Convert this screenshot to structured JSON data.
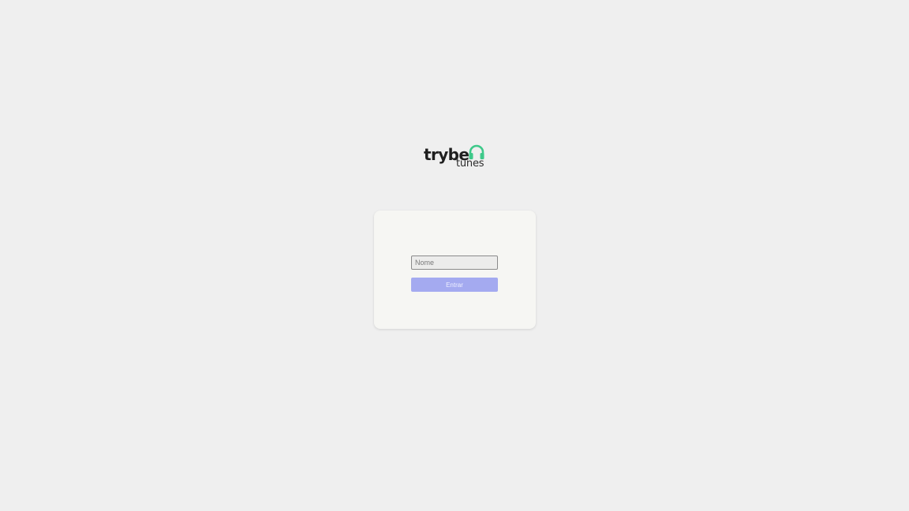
{
  "brand": {
    "word": "trybe",
    "sub": "tunes",
    "icon": "headphones-icon",
    "icon_color": "#3ec98a"
  },
  "login": {
    "name_value": "",
    "name_placeholder": "Nome",
    "enter_label": "Entrar",
    "enter_disabled": true
  },
  "colors": {
    "background": "#efefef",
    "card": "#f6f6f3",
    "button": "#a4aaf0"
  }
}
